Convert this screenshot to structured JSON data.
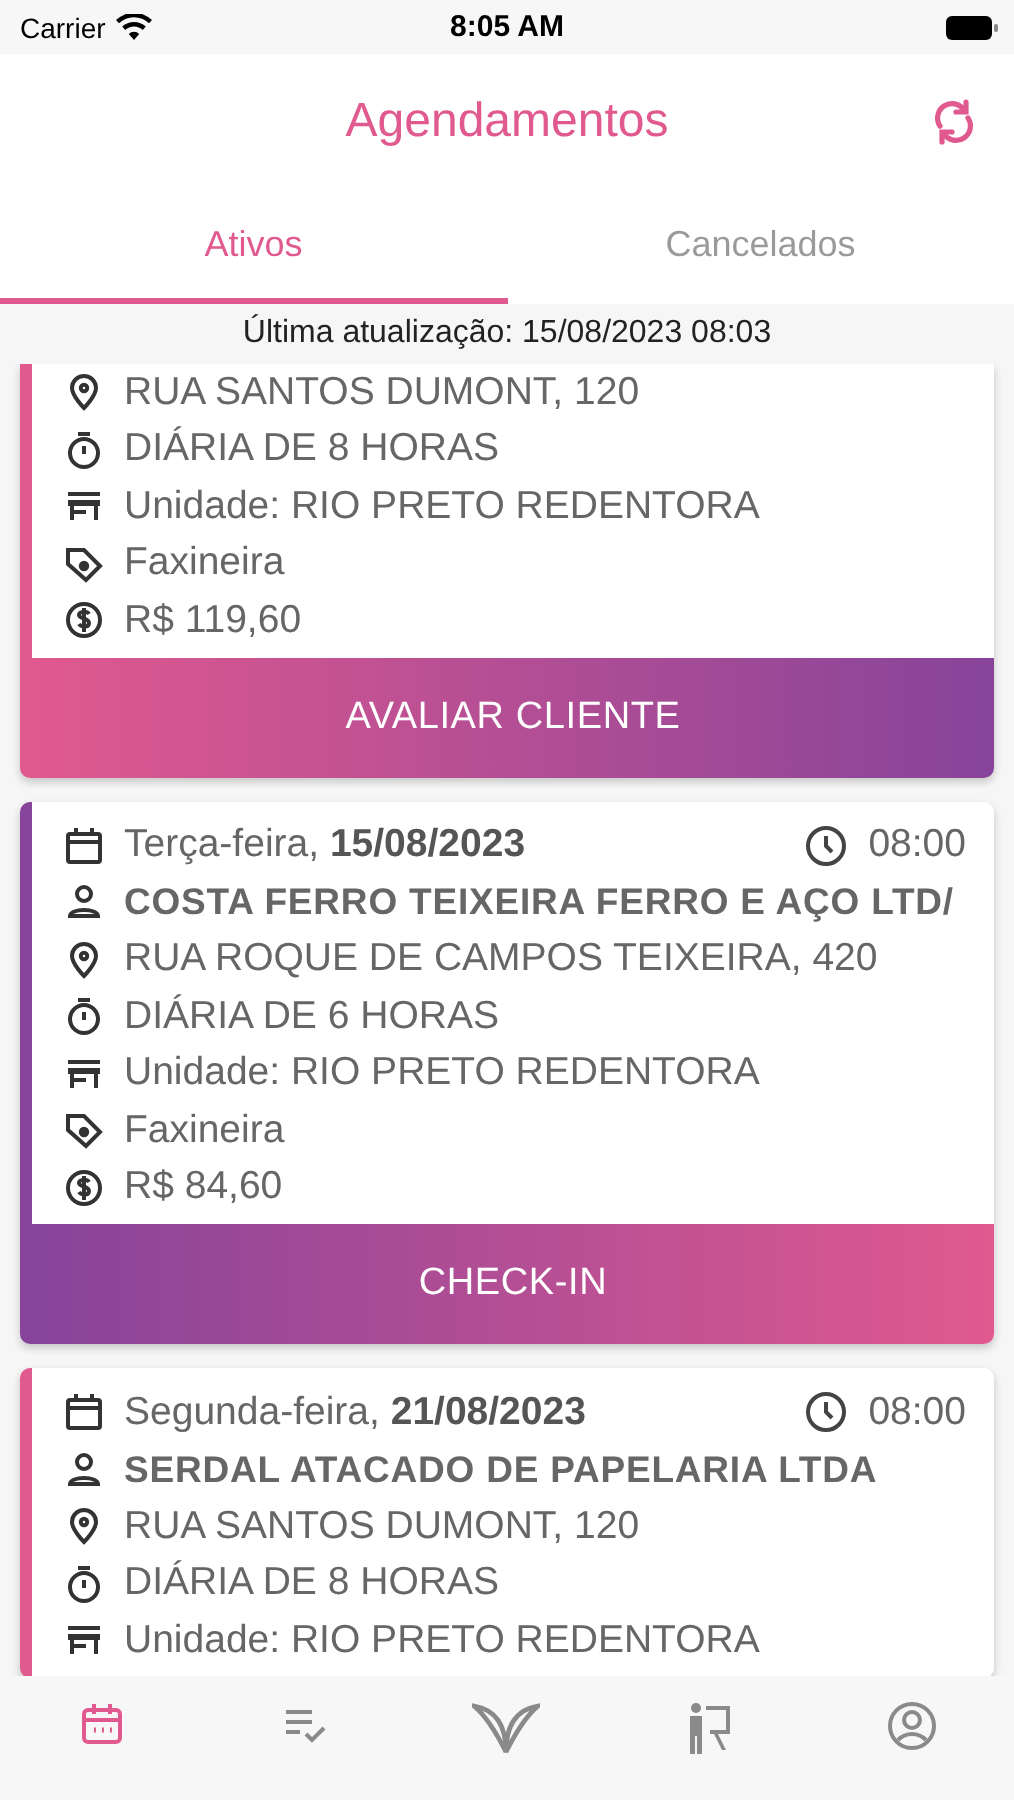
{
  "status_bar": {
    "carrier": "Carrier",
    "time": "8:05 AM"
  },
  "header": {
    "title": "Agendamentos"
  },
  "tabs": [
    {
      "label": "Ativos",
      "selected": true
    },
    {
      "label": "Cancelados",
      "selected": false
    }
  ],
  "last_update": "Última atualização: 15/08/2023 08:03",
  "cards": [
    {
      "color": "#e0598f",
      "lines": [
        {
          "kind": "address",
          "text": "RUA SANTOS DUMONT, 120"
        },
        {
          "kind": "duration",
          "text": "DIÁRIA DE 8 HORAS"
        },
        {
          "kind": "unit",
          "text": "Unidade: RIO PRETO REDENTORA"
        },
        {
          "kind": "role",
          "text": "Faxineira"
        },
        {
          "kind": "price",
          "text": "R$ 119,60"
        }
      ],
      "button": "AVALIAR CLIENTE"
    },
    {
      "color": "#87449a",
      "date": {
        "weekday": "Terça-feira,",
        "date": "15/08/2023",
        "time": "08:00"
      },
      "lines": [
        {
          "kind": "client",
          "text": "COSTA FERRO TEIXEIRA FERRO E AÇO LTD/"
        },
        {
          "kind": "address",
          "text": "RUA ROQUE DE CAMPOS TEIXEIRA, 420"
        },
        {
          "kind": "duration",
          "text": "DIÁRIA DE 6 HORAS"
        },
        {
          "kind": "unit",
          "text": "Unidade: RIO PRETO REDENTORA"
        },
        {
          "kind": "role",
          "text": "Faxineira"
        },
        {
          "kind": "price",
          "text": "R$ 84,60"
        }
      ],
      "button": "CHECK-IN"
    },
    {
      "color": "#e0598f",
      "date": {
        "weekday": "Segunda-feira,",
        "date": "21/08/2023",
        "time": "08:00"
      },
      "lines": [
        {
          "kind": "client",
          "text": "SERDAL ATACADO DE PAPELARIA LTDA"
        },
        {
          "kind": "address",
          "text": "RUA SANTOS DUMONT, 120"
        },
        {
          "kind": "duration",
          "text": "DIÁRIA DE 8 HORAS"
        },
        {
          "kind": "unit",
          "text": "Unidade: RIO PRETO REDENTORA"
        }
      ]
    }
  ],
  "bottom_nav": [
    {
      "kind": "calendar",
      "selected": true
    },
    {
      "kind": "checklist",
      "selected": false
    },
    {
      "kind": "leaf",
      "selected": false
    },
    {
      "kind": "teacher",
      "selected": false
    },
    {
      "kind": "profile",
      "selected": false
    }
  ]
}
